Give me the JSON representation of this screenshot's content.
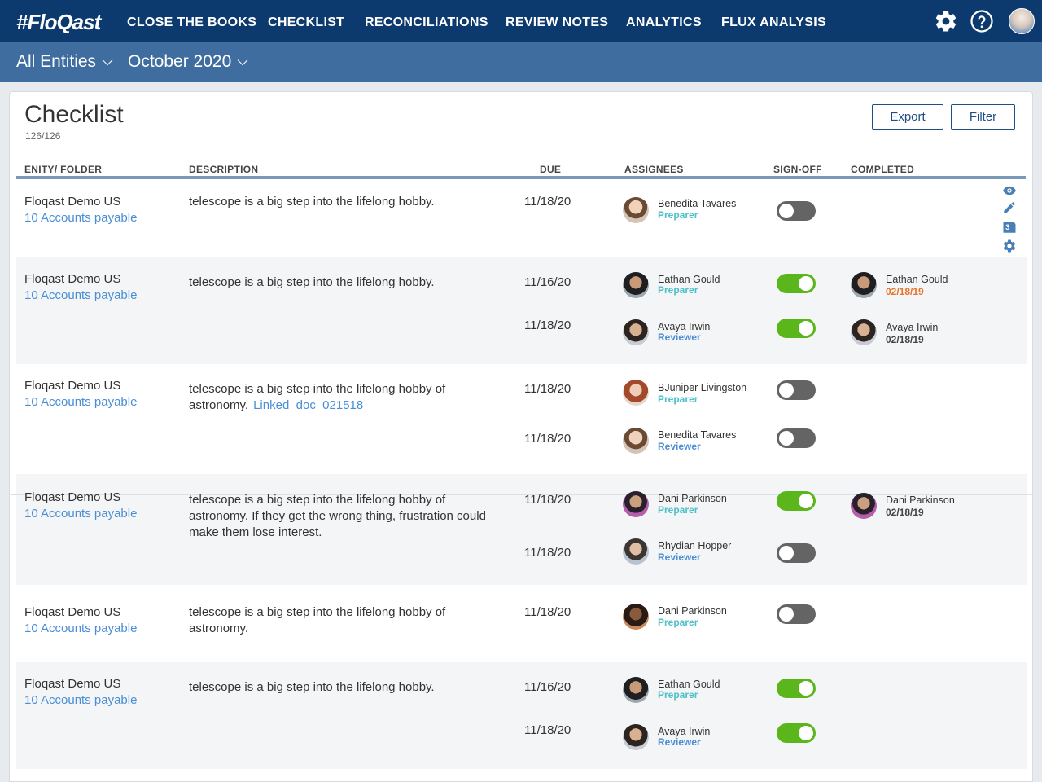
{
  "app": {
    "logo": "#FloQast"
  },
  "nav": [
    {
      "label": "CLOSE THE BOOKS"
    },
    {
      "label": "CHECKLIST"
    },
    {
      "label": "RECONCILIATIONS"
    },
    {
      "label": "REVIEW NOTES"
    },
    {
      "label": "ANALYTICS"
    },
    {
      "label": "FLUX ANALYSIS"
    }
  ],
  "top_icons": [
    "gear-icon",
    "help-icon",
    "user-avatar"
  ],
  "subbar": {
    "entity": "All Entities",
    "period": "October 2020"
  },
  "page": {
    "title": "Checklist",
    "count": "126/126",
    "export_label": "Export",
    "filter_label": "Filter"
  },
  "columns": {
    "entity": "ENITY/ FOLDER",
    "description": "DESCRIPTION",
    "due": "DUE",
    "assignees": "ASSIGNEES",
    "signoff": "SIGN-OFF",
    "completed": "COMPLETED"
  },
  "row_icons": [
    "eye-icon",
    "pencil-icon",
    "comment-count-icon",
    "gear-icon"
  ],
  "row_icon_comment_count": "3",
  "rows": [
    {
      "entity": "Floqast Demo US",
      "folder": "10 Accounts payable",
      "description": "telescope is a big step into the lifelong hobby.",
      "assignees": [
        {
          "due": "11/18/20",
          "name": "Benedita Tavares",
          "role": "Preparer",
          "signed": false
        }
      ]
    },
    {
      "entity": "Floqast Demo US",
      "folder": "10 Accounts payable",
      "description": "telescope is a big step into the lifelong hobby.",
      "assignees": [
        {
          "due": "11/16/20",
          "name": "Eathan Gould",
          "role": "Preparer",
          "signed": true,
          "completed_name": "Eathan Gould",
          "completed_date": "02/18/19"
        },
        {
          "due": "11/18/20",
          "name": "Avaya Irwin",
          "role": "Reviewer",
          "signed": true,
          "completed_name": "Avaya Irwin",
          "completed_date": "02/18/19"
        }
      ]
    },
    {
      "entity": "Floqast Demo US",
      "folder": "10 Accounts payable",
      "description": "telescope is a big step into the lifelong hobby of astronomy.",
      "link": "Linked_doc_021518",
      "assignees": [
        {
          "due": "11/18/20",
          "name": "BJuniper Livingston",
          "role": "Preparer",
          "signed": false
        },
        {
          "due": "11/18/20",
          "name": "Benedita Tavares",
          "role": "Reviewer",
          "signed": false
        }
      ]
    },
    {
      "entity": "Floqast Demo US",
      "folder": "10 Accounts payable",
      "description": "telescope is a big step into the lifelong hobby of astronomy. If they get the wrong thing, frustration could make them lose interest.",
      "assignees": [
        {
          "due": "11/18/20",
          "name": "Dani Parkinson",
          "role": "Preparer",
          "signed": true,
          "completed_name": "Dani Parkinson",
          "completed_date": "02/18/19"
        },
        {
          "due": "11/18/20",
          "name": "Rhydian Hopper",
          "role": "Reviewer",
          "signed": false
        }
      ]
    },
    {
      "entity": "Floqast Demo US",
      "folder": "10 Accounts payable",
      "description": "telescope is a big step into the lifelong hobby of astronomy.",
      "assignees": [
        {
          "due": "11/18/20",
          "name": "Dani Parkinson",
          "role": "Preparer",
          "signed": false
        }
      ]
    },
    {
      "entity": "Floqast Demo US",
      "folder": "10 Accounts payable",
      "description": "telescope is a big step into the lifelong hobby.",
      "assignees": [
        {
          "due": "11/16/20",
          "name": "Eathan Gould",
          "role": "Preparer",
          "signed": true
        },
        {
          "due": "11/18/20",
          "name": "Avaya Irwin",
          "role": "Reviewer",
          "signed": true
        }
      ]
    }
  ]
}
